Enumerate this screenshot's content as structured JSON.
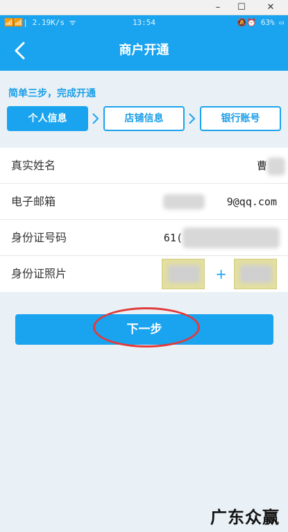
{
  "window": {
    "minimize": "–",
    "maximize": "☐",
    "close": "✕"
  },
  "statusbar": {
    "left": "📶📶| 2.19K/s ᯤ",
    "time": "13:54",
    "right": "🔕⏰ 63% ▭"
  },
  "navbar": {
    "title": "商户开通",
    "back_icon": "chevron-left-icon"
  },
  "steps": {
    "title": "简单三步，完成开通",
    "items": [
      {
        "label": "个人信息",
        "active": true
      },
      {
        "label": "店铺信息",
        "active": false
      },
      {
        "label": "银行账号",
        "active": false
      }
    ]
  },
  "form": {
    "rows": [
      {
        "label": "真实姓名",
        "value": "曹"
      },
      {
        "label": "电子邮箱",
        "value": "9@qq.com"
      },
      {
        "label": "身份证号码",
        "value": "61("
      },
      {
        "label": "身份证照片",
        "plus": "+"
      }
    ]
  },
  "next_button": {
    "label": "下一步"
  },
  "watermark": "广东众赢",
  "colors": {
    "primary": "#1aa3ee",
    "highlight": "#e23a3a"
  }
}
